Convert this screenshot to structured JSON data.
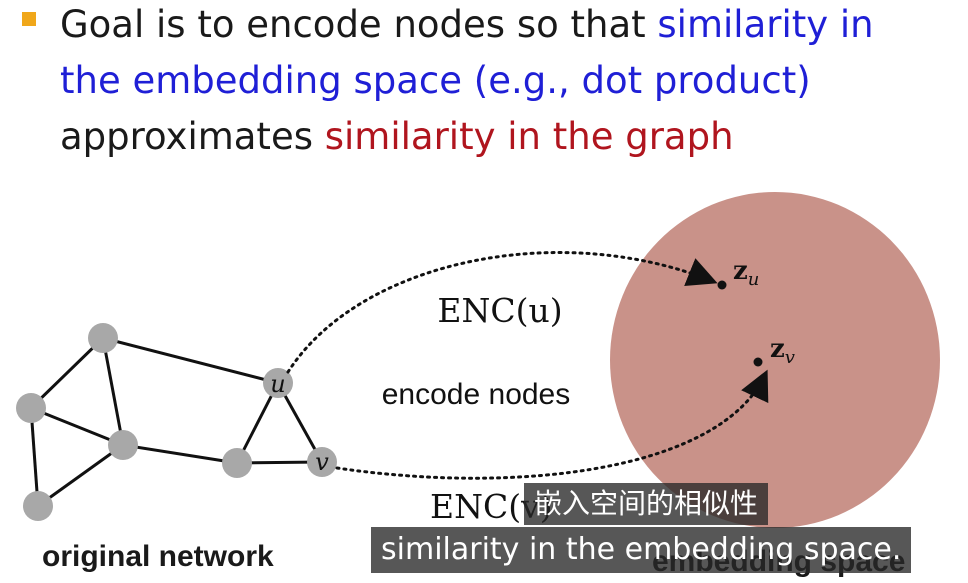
{
  "bullet": {
    "line1_plain": "Goal is to encode nodes so that ",
    "line1_blue": "similarity in",
    "line2_blue": "the embedding space (e.g., dot product)",
    "line3_plain": "approximates ",
    "line3_red": "similarity in the graph"
  },
  "diagram": {
    "node_u_label": "u",
    "node_v_label": "v",
    "enc_u_label": "ENC(u)",
    "enc_v_label": "ENC(v)",
    "center_label": "encode nodes",
    "zu_bold": "z",
    "zu_sub": "u",
    "zv_bold": "z",
    "zv_sub": "v",
    "left_caption": "original network",
    "right_caption": "embedding space"
  },
  "subtitles": {
    "chinese": "嵌入空间的相似性",
    "english": "similarity in the embedding space."
  },
  "colors": {
    "bullet": "#f0a71a",
    "blue_text": "#1f1fd6",
    "red_text": "#b0151e",
    "node_fill": "#a8a8a8",
    "embedding_blob": "#c99289"
  }
}
